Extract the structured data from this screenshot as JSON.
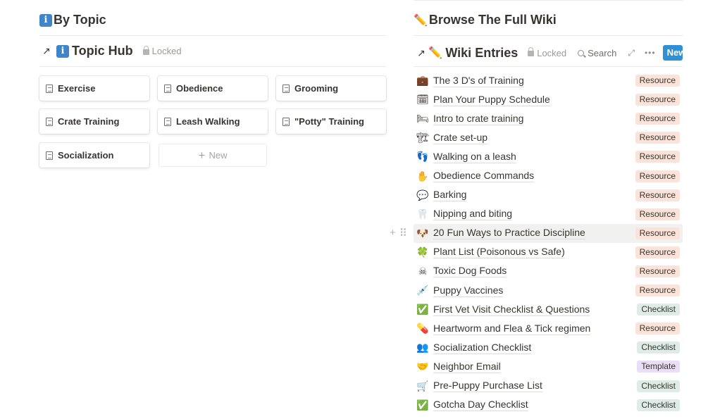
{
  "left": {
    "heading": "By Topic",
    "hub": {
      "title": "Topic Hub",
      "locked": "Locked",
      "cards": [
        "Exercise",
        "Obedience",
        "Grooming",
        "Crate Training",
        "Leash Walking",
        "\"Potty\" Training",
        "Socialization"
      ],
      "new_label": "New"
    }
  },
  "right": {
    "heading": "Browse The Full Wiki",
    "db": {
      "title": "Wiki Entries",
      "locked": "Locked",
      "search": "Search",
      "new_button": "New"
    },
    "entries": [
      {
        "icon": "💼",
        "title": "The 3 D's of Training",
        "tag": "Resource"
      },
      {
        "icon": "🗓",
        "title": "Plan Your Puppy Schedule",
        "tag": "Resource"
      },
      {
        "icon": "🛏",
        "title": "Intro to crate training",
        "tag": "Resource"
      },
      {
        "icon": "🏗",
        "title": "Crate set-up",
        "tag": "Resource"
      },
      {
        "icon": "👣",
        "title": "Walking on a leash",
        "tag": "Resource"
      },
      {
        "icon": "✋",
        "title": "Obedience Commands",
        "tag": "Resource"
      },
      {
        "icon": "💬",
        "title": "Barking",
        "tag": "Resource"
      },
      {
        "icon": "🦷",
        "title": "Nipping and biting",
        "tag": "Resource"
      },
      {
        "icon": "🐶",
        "title": "20 Fun Ways to Practice Discipline",
        "tag": "Resource"
      },
      {
        "icon": "🍀",
        "title": "Plant List (Poisonous vs Safe)",
        "tag": "Resource"
      },
      {
        "icon": "☠",
        "title": "Toxic Dog Foods",
        "tag": "Resource"
      },
      {
        "icon": "💉",
        "title": "Puppy Vaccines",
        "tag": "Resource"
      },
      {
        "icon": "✅",
        "title": "First Vet Visit Checklist & Questions",
        "tag": "Checklist"
      },
      {
        "icon": "💊",
        "title": "Heartworm and Flea & Tick regimen",
        "tag": "Resource"
      },
      {
        "icon": "👥",
        "title": "Socialization Checklist",
        "tag": "Checklist"
      },
      {
        "icon": "🤝",
        "title": "Neighbor Email",
        "tag": "Template"
      },
      {
        "icon": "🛒",
        "title": "Pre-Puppy Purchase List",
        "tag": "Checklist"
      },
      {
        "icon": "✅",
        "title": "Gotcha Day Checklist",
        "tag": "Checklist"
      }
    ]
  },
  "colors": {
    "accent_button": "#2f91d4",
    "tag_resource": "#fbe3d9",
    "tag_checklist": "#dfece6",
    "tag_template": "#e9def5"
  }
}
